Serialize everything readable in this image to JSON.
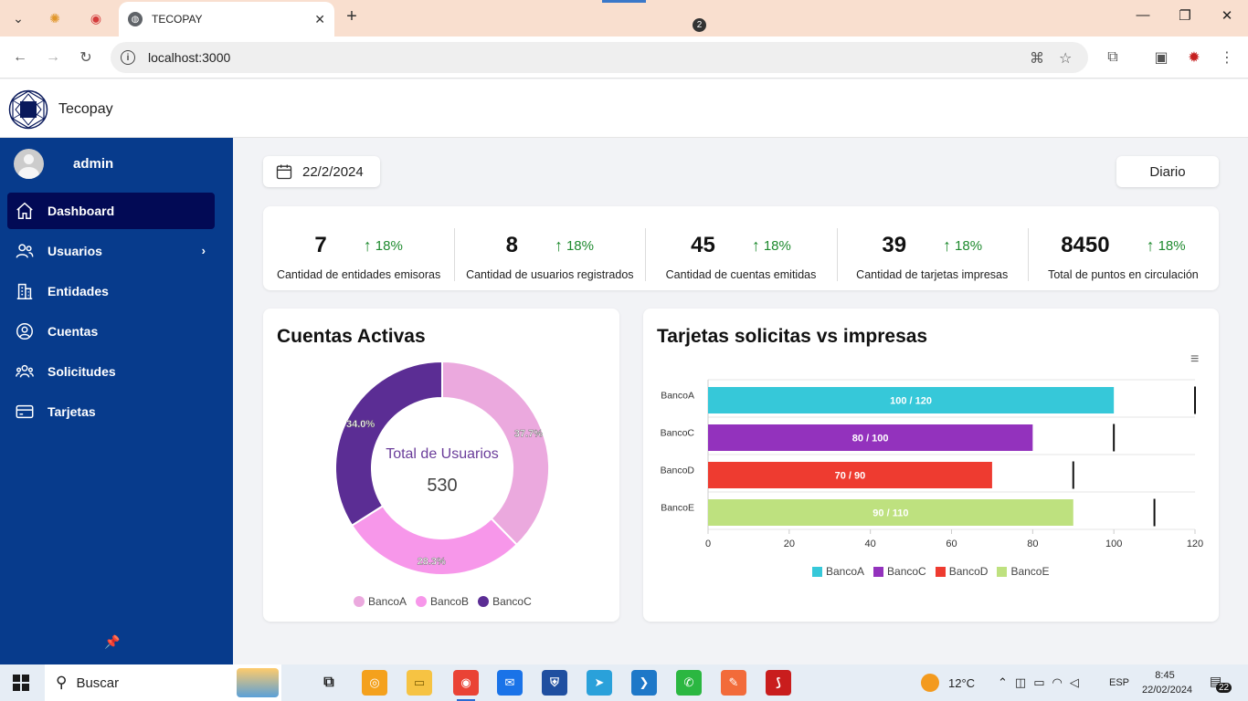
{
  "browser": {
    "tab_title": "TECOPAY",
    "url": "localhost:3000"
  },
  "app": {
    "name": "Tecopay",
    "user": "admin"
  },
  "nav": {
    "items": [
      {
        "label": "Dashboard",
        "icon": "home-icon"
      },
      {
        "label": "Usuarios",
        "icon": "users-icon"
      },
      {
        "label": "Entidades",
        "icon": "building-icon"
      },
      {
        "label": "Cuentas",
        "icon": "user-circle-icon"
      },
      {
        "label": "Solicitudes",
        "icon": "user-group-icon"
      },
      {
        "label": "Tarjetas",
        "icon": "credit-card-icon"
      }
    ]
  },
  "filters": {
    "date": "22/2/2024",
    "period": "Diario"
  },
  "stats": [
    {
      "value": "7",
      "trend": "18%",
      "label": "Cantidad de entidades emisoras"
    },
    {
      "value": "8",
      "trend": "18%",
      "label": "Cantidad de usuarios registrados"
    },
    {
      "value": "45",
      "trend": "18%",
      "label": "Cantidad de cuentas emitidas"
    },
    {
      "value": "39",
      "trend": "18%",
      "label": "Cantidad de tarjetas impresas"
    },
    {
      "value": "8450",
      "trend": "18%",
      "label": "Total de puntos en circulación"
    }
  ],
  "chart_data": [
    {
      "type": "pie",
      "title": "Cuentas Activas",
      "center_label": "Total de Usuarios",
      "center_value": "530",
      "categories": [
        "BancoA",
        "BancoB",
        "BancoC"
      ],
      "values": [
        37.7,
        28.3,
        34.0
      ],
      "value_labels": [
        "37.7%",
        "28.3%",
        "34.0%"
      ],
      "colors": [
        "#eba9de",
        "#f797ea",
        "#5b2d94"
      ],
      "legend": "bottom"
    },
    {
      "type": "bar",
      "orientation": "horizontal",
      "title": "Tarjetas solicitas vs impresas",
      "categories": [
        "BancoA",
        "BancoC",
        "BancoD",
        "BancoE"
      ],
      "values": [
        100,
        80,
        70,
        90
      ],
      "targets": [
        120,
        100,
        90,
        110
      ],
      "data_labels": [
        "100 / 120",
        "80 / 100",
        "70 / 90",
        "90 / 110"
      ],
      "colors": [
        "#36c8d9",
        "#9332bd",
        "#ee3b30",
        "#bee17f"
      ],
      "xlim": [
        0,
        120
      ],
      "xticks": [
        "0",
        "20",
        "40",
        "60",
        "80",
        "100",
        "120"
      ],
      "legend": "bottom"
    }
  ],
  "taskbar": {
    "search_placeholder": "Buscar",
    "weather": "12°C",
    "lang": "ESP",
    "time": "8:45",
    "date": "22/02/2024",
    "notifications": "22",
    "whatsapp_badge": "2"
  }
}
